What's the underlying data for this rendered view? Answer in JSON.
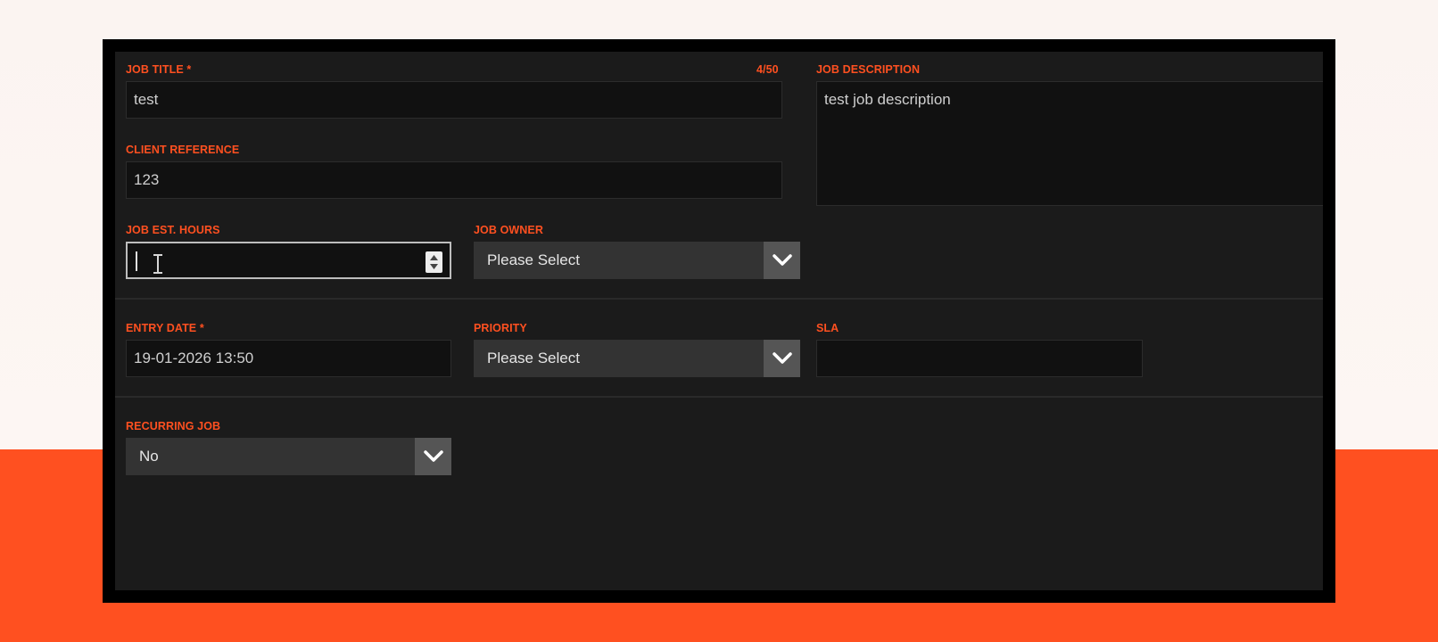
{
  "form": {
    "job_title": {
      "label": "JOB TITLE *",
      "counter": "4/50",
      "value": "test"
    },
    "job_description": {
      "label": "JOB DESCRIPTION",
      "value": "test job description"
    },
    "client_reference": {
      "label": "CLIENT REFERENCE",
      "value": "123"
    },
    "job_est_hours": {
      "label": "JOB EST. HOURS",
      "value": ""
    },
    "job_owner": {
      "label": "JOB OWNER",
      "selected": "Please Select"
    },
    "entry_date": {
      "label": "ENTRY DATE *",
      "value": "19-01-2026 13:50"
    },
    "priority": {
      "label": "PRIORITY",
      "selected": "Please Select"
    },
    "sla": {
      "label": "SLA",
      "value": ""
    },
    "recurring_job": {
      "label": "RECURRING JOB",
      "selected": "No"
    }
  },
  "colors": {
    "accent": "#ff5020",
    "panel": "#1b1b1b",
    "field": "#111111",
    "select": "#333333",
    "select_button": "#555555"
  },
  "icons": {
    "dropdown": "chevron-down-icon",
    "spinner": "number-spinner-icon",
    "cursor": "text-cursor-icon"
  }
}
